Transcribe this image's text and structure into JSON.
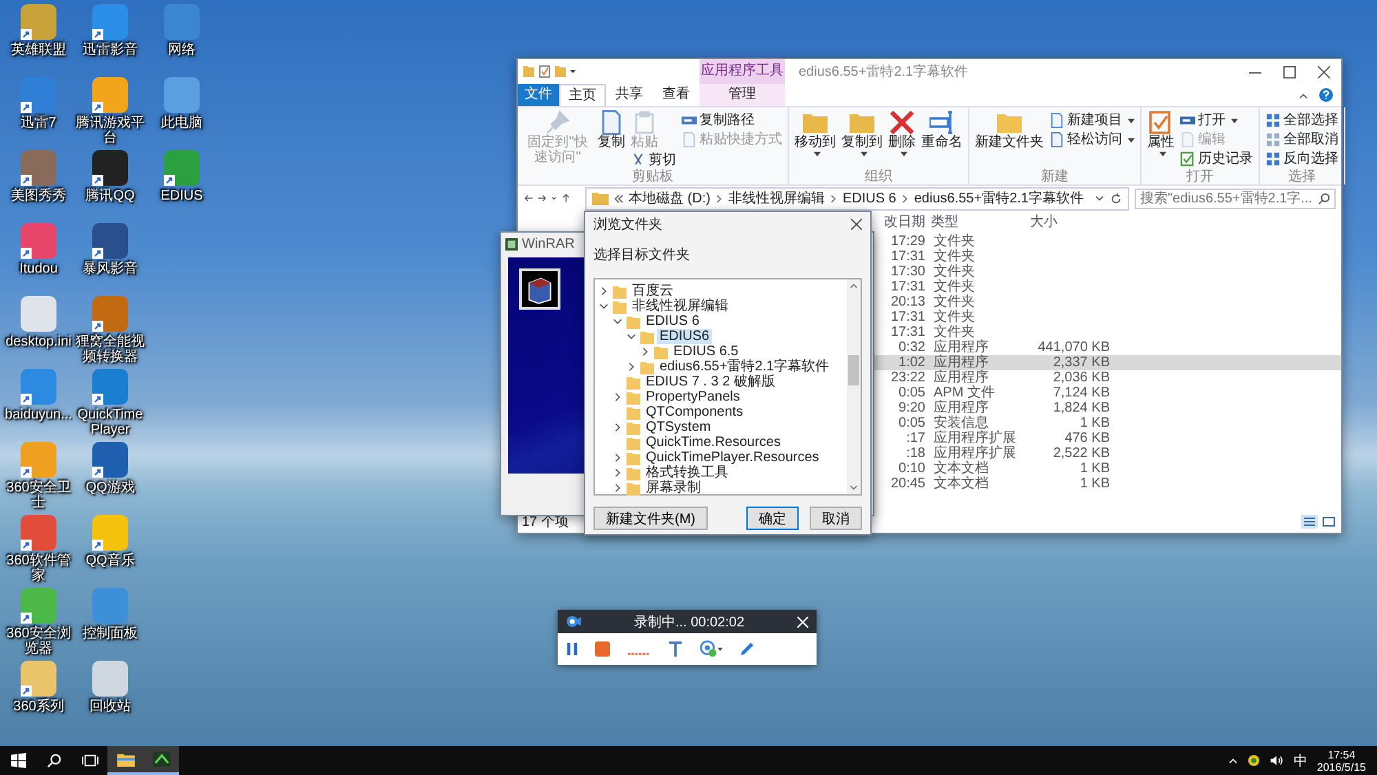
{
  "desktop_icons": [
    {
      "label": "英雄联盟",
      "color": "#c9a23a",
      "shortcut": true
    },
    {
      "label": "迅雷7",
      "color": "#2f7fd6",
      "shortcut": true
    },
    {
      "label": "美图秀秀",
      "color": "#8a6a58",
      "shortcut": true
    },
    {
      "label": "Itudou",
      "color": "#e8456a",
      "shortcut": true
    },
    {
      "label": "desktop.ini",
      "color": "#dfe4ea",
      "shortcut": false
    },
    {
      "label": "baiduyun...",
      "color": "#2c8ae0",
      "shortcut": true
    },
    {
      "label": "360安全卫士",
      "color": "#f0a020",
      "shortcut": true
    },
    {
      "label": "360软件管家",
      "color": "#e24c3a",
      "shortcut": true
    },
    {
      "label": "360安全浏览器",
      "color": "#4cb848",
      "shortcut": true
    },
    {
      "label": "360系列",
      "color": "#e9c46a",
      "shortcut": true
    },
    {
      "label": "迅雷影音",
      "color": "#2b8fe8",
      "shortcut": true
    },
    {
      "label": "腾讯游戏平台",
      "color": "#f2a51a",
      "shortcut": true
    },
    {
      "label": "腾讯QQ",
      "color": "#222222",
      "shortcut": true
    },
    {
      "label": "暴风影音",
      "color": "#2a4f8c",
      "shortcut": true
    },
    {
      "label": "狸窝全能视频转换器",
      "color": "#c26a12",
      "shortcut": true
    },
    {
      "label": "QuickTime Player",
      "color": "#1a7fd1",
      "shortcut": true
    },
    {
      "label": "QQ游戏",
      "color": "#1f5fb0",
      "shortcut": true
    },
    {
      "label": "QQ音乐",
      "color": "#f4c20d",
      "shortcut": true
    },
    {
      "label": "控制面板",
      "color": "#3d8fd8",
      "shortcut": false
    },
    {
      "label": "回收站",
      "color": "#cfd8e0",
      "shortcut": false
    },
    {
      "label": "网络",
      "color": "#3a86d0",
      "shortcut": false
    },
    {
      "label": "此电脑",
      "color": "#5aa0e0",
      "shortcut": false
    },
    {
      "label": "EDIUS",
      "color": "#2aa040",
      "shortcut": true
    }
  ],
  "explorer": {
    "context_tab": "应用程序工具",
    "title": "edius6.55+雷特2.1字幕软件",
    "tabs": [
      {
        "label": "文件",
        "kind": "file",
        "selected": false
      },
      {
        "label": "主页",
        "kind": "tab",
        "selected": true
      },
      {
        "label": "共享",
        "kind": "tab",
        "selected": false
      },
      {
        "label": "查看",
        "kind": "tab",
        "selected": false
      },
      {
        "label": "管理",
        "kind": "context",
        "selected": false
      }
    ],
    "groups": [
      {
        "label": "剪贴板",
        "columns": [
          {
            "kind": "large",
            "items": [
              {
                "label": "固定到\"快速访问\"",
                "kind": "pin",
                "disabled": true,
                "dropdown": false
              }
            ]
          },
          {
            "kind": "large",
            "items": [
              {
                "label": "复制",
                "kind": "copy",
                "disabled": false,
                "dropdown": false
              }
            ]
          },
          {
            "kind": "mixed",
            "items": [
              {
                "label": "粘贴",
                "kind": "paste",
                "disabled": true,
                "dropdown": false
              },
              {
                "label": "剪切",
                "kind": "cut",
                "disabled": false,
                "dropdown": false
              }
            ]
          },
          {
            "kind": "stack",
            "items": [
              {
                "label": "复制路径",
                "kind": "path",
                "disabled": false,
                "dropdown": false
              },
              {
                "label": "粘贴快捷方式",
                "kind": "shortcut",
                "disabled": true,
                "dropdown": false
              }
            ]
          }
        ]
      },
      {
        "label": "组织",
        "columns": [
          {
            "kind": "large",
            "items": [
              {
                "label": "移动到",
                "kind": "move",
                "disabled": false,
                "dropdown": true
              }
            ]
          },
          {
            "kind": "large",
            "items": [
              {
                "label": "复制到",
                "kind": "copyto",
                "disabled": false,
                "dropdown": true
              }
            ]
          },
          {
            "kind": "large",
            "items": [
              {
                "label": "删除",
                "kind": "delete",
                "disabled": false,
                "dropdown": true
              }
            ]
          },
          {
            "kind": "large",
            "items": [
              {
                "label": "重命名",
                "kind": "rename",
                "disabled": false,
                "dropdown": false
              }
            ]
          }
        ]
      },
      {
        "label": "新建",
        "columns": [
          {
            "kind": "large",
            "items": [
              {
                "label": "新建文件夹",
                "kind": "newfolder",
                "disabled": false,
                "dropdown": false
              }
            ]
          },
          {
            "kind": "stack",
            "items": [
              {
                "label": "新建项目",
                "kind": "newitem",
                "disabled": false,
                "dropdown": true
              },
              {
                "label": "轻松访问",
                "kind": "easy",
                "disabled": false,
                "dropdown": true
              }
            ]
          }
        ]
      },
      {
        "label": "打开",
        "columns": [
          {
            "kind": "large",
            "items": [
              {
                "label": "属性",
                "kind": "properties",
                "disabled": false,
                "dropdown": true
              }
            ]
          },
          {
            "kind": "stack",
            "items": [
              {
                "label": "打开",
                "kind": "open",
                "disabled": false,
                "dropdown": true
              },
              {
                "label": "编辑",
                "kind": "edit",
                "disabled": true,
                "dropdown": false
              },
              {
                "label": "历史记录",
                "kind": "history",
                "disabled": false,
                "dropdown": false
              }
            ]
          }
        ]
      },
      {
        "label": "选择",
        "columns": [
          {
            "kind": "stack",
            "items": [
              {
                "label": "全部选择",
                "kind": "selectall",
                "disabled": false,
                "dropdown": false
              },
              {
                "label": "全部取消",
                "kind": "selectnone",
                "disabled": false,
                "dropdown": false
              },
              {
                "label": "反向选择",
                "kind": "invert",
                "disabled": false,
                "dropdown": false
              }
            ]
          }
        ]
      }
    ],
    "address": [
      "本地磁盘 (D:)",
      "非线性视屏编辑",
      "EDIUS 6",
      "edius6.55+雷特2.1字幕软件"
    ],
    "search": {
      "placeholder": "搜索\"edius6.55+雷特2.1字..."
    },
    "columns": [
      "改日期",
      "类型",
      "大小"
    ],
    "rows": [
      {
        "date": "17:29",
        "type": "文件夹",
        "selected": false
      },
      {
        "date": "17:31",
        "type": "文件夹",
        "selected": false
      },
      {
        "date": "17:30",
        "type": "文件夹",
        "selected": false
      },
      {
        "date": "17:31",
        "type": "文件夹",
        "selected": false
      },
      {
        "date": "20:13",
        "type": "文件夹",
        "selected": false
      },
      {
        "date": "17:31",
        "type": "文件夹",
        "selected": false
      },
      {
        "date": "17:31",
        "type": "文件夹",
        "selected": false
      },
      {
        "date": "0:32",
        "type": "应用程序",
        "size": "441,070 KB",
        "selected": false
      },
      {
        "date": "1:02",
        "type": "应用程序",
        "size": "2,337 KB",
        "selected": true
      },
      {
        "date": "23:22",
        "type": "应用程序",
        "size": "2,036 KB",
        "selected": false
      },
      {
        "date": "0:05",
        "type": "APM 文件",
        "size": "7,124 KB",
        "selected": false
      },
      {
        "date": "9:20",
        "type": "应用程序",
        "size": "1,824 KB",
        "selected": false
      },
      {
        "date": "0:05",
        "type": "安装信息",
        "size": "1 KB",
        "selected": false
      },
      {
        "date": ":17",
        "type": "应用程序扩展",
        "size": "476 KB",
        "selected": false
      },
      {
        "date": ":18",
        "type": "应用程序扩展",
        "size": "2,522 KB",
        "selected": false
      },
      {
        "date": "0:10",
        "type": "文本文档",
        "size": "1 KB",
        "selected": false
      },
      {
        "date": "20:45",
        "type": "文本文档",
        "size": "1 KB",
        "selected": false
      }
    ],
    "status": "17 个项"
  },
  "winrar": {
    "title": "WinRAR"
  },
  "dialog": {
    "title": "浏览文件夹",
    "prompt": "选择目标文件夹",
    "tree": [
      {
        "label": "百度云",
        "expandable": true,
        "expanded": false,
        "selected": false
      },
      {
        "label": "非线性视屏编辑",
        "expandable": true,
        "expanded": true,
        "selected": false,
        "children": [
          {
            "label": "EDIUS 6",
            "expandable": true,
            "expanded": true,
            "selected": false,
            "children": [
              {
                "label": "EDIUS6",
                "expandable": true,
                "expanded": true,
                "selected": true,
                "children": [
                  {
                    "label": "EDIUS 6.5",
                    "expandable": true,
                    "expanded": false,
                    "selected": false
                  }
                ]
              },
              {
                "label": "edius6.55+雷特2.1字幕软件",
                "expandable": true,
                "expanded": false,
                "selected": false
              }
            ]
          },
          {
            "label": "EDIUS 7 . 3 2 破解版",
            "expandable": false,
            "expanded": false,
            "selected": false
          },
          {
            "label": "PropertyPanels",
            "expandable": true,
            "expanded": false,
            "selected": false
          },
          {
            "label": "QTComponents",
            "expandable": false,
            "expanded": false,
            "selected": false
          },
          {
            "label": "QTSystem",
            "expandable": true,
            "expanded": false,
            "selected": false
          },
          {
            "label": "QuickTime.Resources",
            "expandable": false,
            "expanded": false,
            "selected": false
          },
          {
            "label": "QuickTimePlayer.Resources",
            "expandable": true,
            "expanded": false,
            "selected": false
          },
          {
            "label": "格式转换工具",
            "expandable": true,
            "expanded": false,
            "selected": false
          },
          {
            "label": "屏幕录制",
            "expandable": true,
            "expanded": false,
            "selected": false
          }
        ]
      }
    ],
    "buttons": [
      {
        "label": "新建文件夹(M)",
        "kind": "normal"
      },
      {
        "label": "确定",
        "kind": "default"
      },
      {
        "label": "取消",
        "kind": "normal"
      }
    ]
  },
  "recorder": {
    "status": "录制中... 00:02:02"
  },
  "taskbar": {
    "apps": [
      {
        "kind": "start",
        "active": false
      },
      {
        "kind": "search",
        "active": false
      },
      {
        "kind": "task_view",
        "active": false
      },
      {
        "kind": "file_explorer",
        "active": true
      },
      {
        "kind": "edius",
        "active": true
      }
    ],
    "ime": "中",
    "time": "17:54",
    "date": "2016/5/15"
  }
}
